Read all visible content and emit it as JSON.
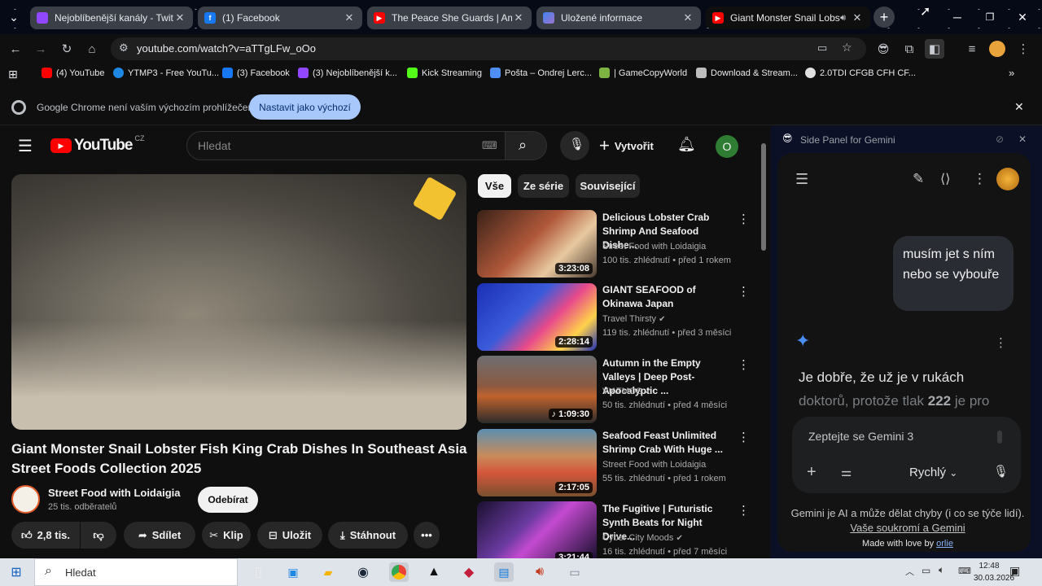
{
  "browser": {
    "tabs": [
      {
        "title": "Nejoblíbenější kanály - Twitch",
        "icon": "twitch-icon",
        "color": "#9146ff"
      },
      {
        "title": "(1) Facebook",
        "icon": "facebook-icon",
        "color": "#1877f2"
      },
      {
        "title": "The Peace She Guards | Ambien",
        "icon": "youtube-icon",
        "color": "#ff0000"
      },
      {
        "title": "Uložené informace",
        "icon": "gemini-icon",
        "color": "#6d9cf7"
      },
      {
        "title": "Giant Monster Snail Lobster",
        "icon": "youtube-icon",
        "color": "#ff0000",
        "active": true
      }
    ],
    "url": "youtube.com/watch?v=aTTgLFw_oOo",
    "bookmarks": [
      {
        "label": "(4) YouTube",
        "color": "#ff0000"
      },
      {
        "label": "YTMP3 - Free YouTu...",
        "color": "#1e88e5"
      },
      {
        "label": "(3) Facebook",
        "color": "#1877f2"
      },
      {
        "label": "(3) Nejoblíbenější k...",
        "color": "#9146ff"
      },
      {
        "label": "Kick Streaming",
        "color": "#53fc18"
      },
      {
        "label": "Pošta – Ondrej Lerc...",
        "color": "#4f8ef7"
      },
      {
        "label": "| GameCopyWorld",
        "color": "#7cb342"
      },
      {
        "label": "Download & Stream...",
        "color": "#bdbdbd"
      },
      {
        "label": "2.0TDI CFGB CFH CF...",
        "color": "#e0e0e0"
      }
    ],
    "infobar": {
      "text": "Google Chrome není vaším výchozím prohlížečem",
      "button": "Nastavit jako výchozí"
    }
  },
  "youtube": {
    "logo": "YouTube",
    "region": "CZ",
    "search_placeholder": "Hledat",
    "create_label": "Vytvořit",
    "avatar_letter": "O",
    "video": {
      "title": "Giant Monster Snail Lobster Fish King Crab Dishes In Southeast Asia Street Foods Collection 2025",
      "channel": "Street Food with Loidaigia",
      "subscribers": "25 tis. odběratelů",
      "subscribe_label": "Odebírat",
      "likes": "2,8 tis.",
      "share_label": "Sdílet",
      "clip_label": "Klip",
      "save_label": "Uložit",
      "download_label": "Stáhnout"
    },
    "chips": [
      "Vše",
      "Ze série",
      "Související"
    ],
    "recommendations": [
      {
        "title": "Delicious Lobster Crab Shrimp And Seafood Dishe...",
        "channel": "Street Food with Loidaigia",
        "verified": false,
        "meta": "100 tis. zhlédnutí • před 1 rokem",
        "duration": "3:23:08",
        "thumb": "#7a3b2a"
      },
      {
        "title": "GIANT SEAFOOD of Okinawa Japan",
        "channel": "Travel Thirsty",
        "verified": true,
        "meta": "119 tis. zhlédnutí • před 3 měsíci",
        "duration": "2:28:14",
        "thumb": "#3b4bbf"
      },
      {
        "title": "Autumn in the Empty Valleys | Deep Post-Apocalyptic ...",
        "channel": "VIATMOS",
        "verified": true,
        "meta": "50 tis. zhlédnutí • před 4 měsíci",
        "duration": "1:09:30",
        "thumb": "#6a5a4c"
      },
      {
        "title": "Seafood Feast Unlimited Shrimp Crab With Huge ...",
        "channel": "Street Food with Loidaigia",
        "verified": false,
        "meta": "55 tis. zhlédnutí • před 1 rokem",
        "duration": "2:17:05",
        "thumb": "#8b5a3a"
      },
      {
        "title": "The Fugitive | Futuristic Synth Beats for Night Drive...",
        "channel": "Cyber City Moods",
        "verified": true,
        "meta": "16 tis. zhlédnutí • před 7 měsíci",
        "duration": "3:21:44",
        "thumb": "#3a2a5a"
      }
    ]
  },
  "gemini": {
    "panel_title": "Side Panel for Gemini",
    "user_message": "musím jet s ním nebo se vybouře",
    "response_line1": "Je dobře, že už je v rukách",
    "response_line2_pre": "doktorů, protože tlak ",
    "response_line2_bold": "222",
    "response_line2_post": " je pro",
    "input_placeholder": "Zeptejte se Gemini 3",
    "mode": "Rychlý",
    "disclaimer": "Gemini je AI a může dělat chyby (i co se týče lidí).",
    "privacy_link": "Vaše soukromí a Gemini",
    "made_with_love": "Made with love by",
    "made_with_love_link": "orlie"
  },
  "taskbar": {
    "search_placeholder": "Hledat",
    "time": "12:48",
    "date": "30.03.2026"
  }
}
